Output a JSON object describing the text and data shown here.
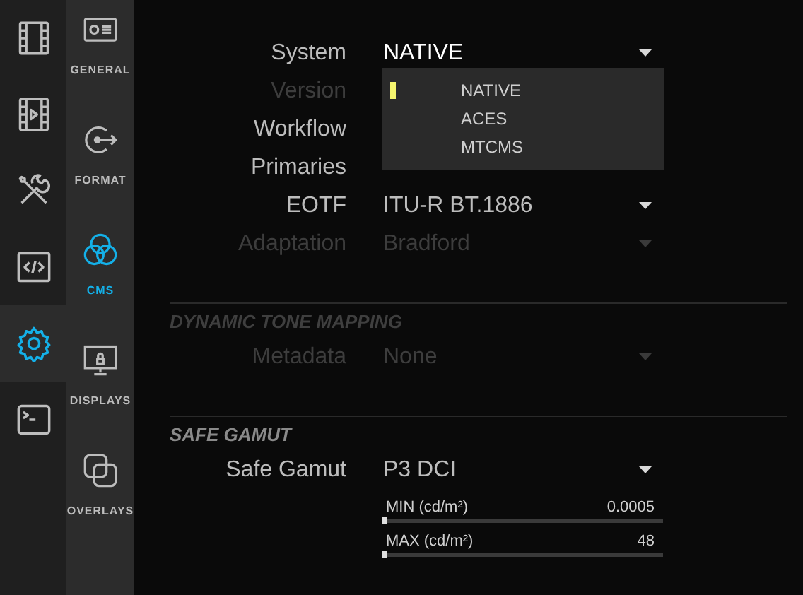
{
  "rail": [
    {
      "kind": "film",
      "selected": false
    },
    {
      "kind": "film-play",
      "selected": false
    },
    {
      "kind": "tools",
      "selected": false
    },
    {
      "kind": "code",
      "selected": false
    },
    {
      "kind": "gear",
      "selected": true
    },
    {
      "kind": "terminal",
      "selected": false
    }
  ],
  "categories": [
    {
      "kind": "general",
      "label": "GENERAL",
      "selected": false
    },
    {
      "kind": "format",
      "label": "FORMAT",
      "selected": false
    },
    {
      "kind": "cms",
      "label": "CMS",
      "selected": true
    },
    {
      "kind": "displays",
      "label": "DISPLAYS",
      "selected": false
    },
    {
      "kind": "overlays",
      "label": "OVERLAYS",
      "selected": false
    }
  ],
  "settings": [
    {
      "label": "System",
      "value": "NATIVE",
      "disabled": false,
      "open": true
    },
    {
      "label": "Version",
      "disabled": true
    },
    {
      "label": "Workflow",
      "disabled": false
    },
    {
      "label": "Primaries",
      "disabled": false
    },
    {
      "label": "EOTF",
      "value": "ITU-R BT.1886",
      "disabled": false
    },
    {
      "label": "Adaptation",
      "value": "Bradford",
      "disabled": true
    }
  ],
  "dropdown": {
    "options": [
      {
        "label": "NATIVE",
        "selected": true
      },
      {
        "label": "ACES",
        "selected": false
      },
      {
        "label": "MTCMS",
        "selected": false
      }
    ]
  },
  "dynamic_tone_mapping": {
    "title": "DYNAMIC TONE MAPPING",
    "settings": [
      {
        "label": "Metadata",
        "value": "None",
        "disabled": true
      }
    ]
  },
  "safe_gamut": {
    "title": "SAFE GAMUT",
    "settings": [
      {
        "label": "Safe Gamut",
        "value": "P3 DCI",
        "disabled": false
      }
    ],
    "sliders": [
      {
        "label": "MIN (cd/m²)",
        "reading": "0.0005",
        "level": 0
      },
      {
        "label": "MAX (cd/m²)",
        "reading": "48",
        "level": 0
      }
    ]
  }
}
